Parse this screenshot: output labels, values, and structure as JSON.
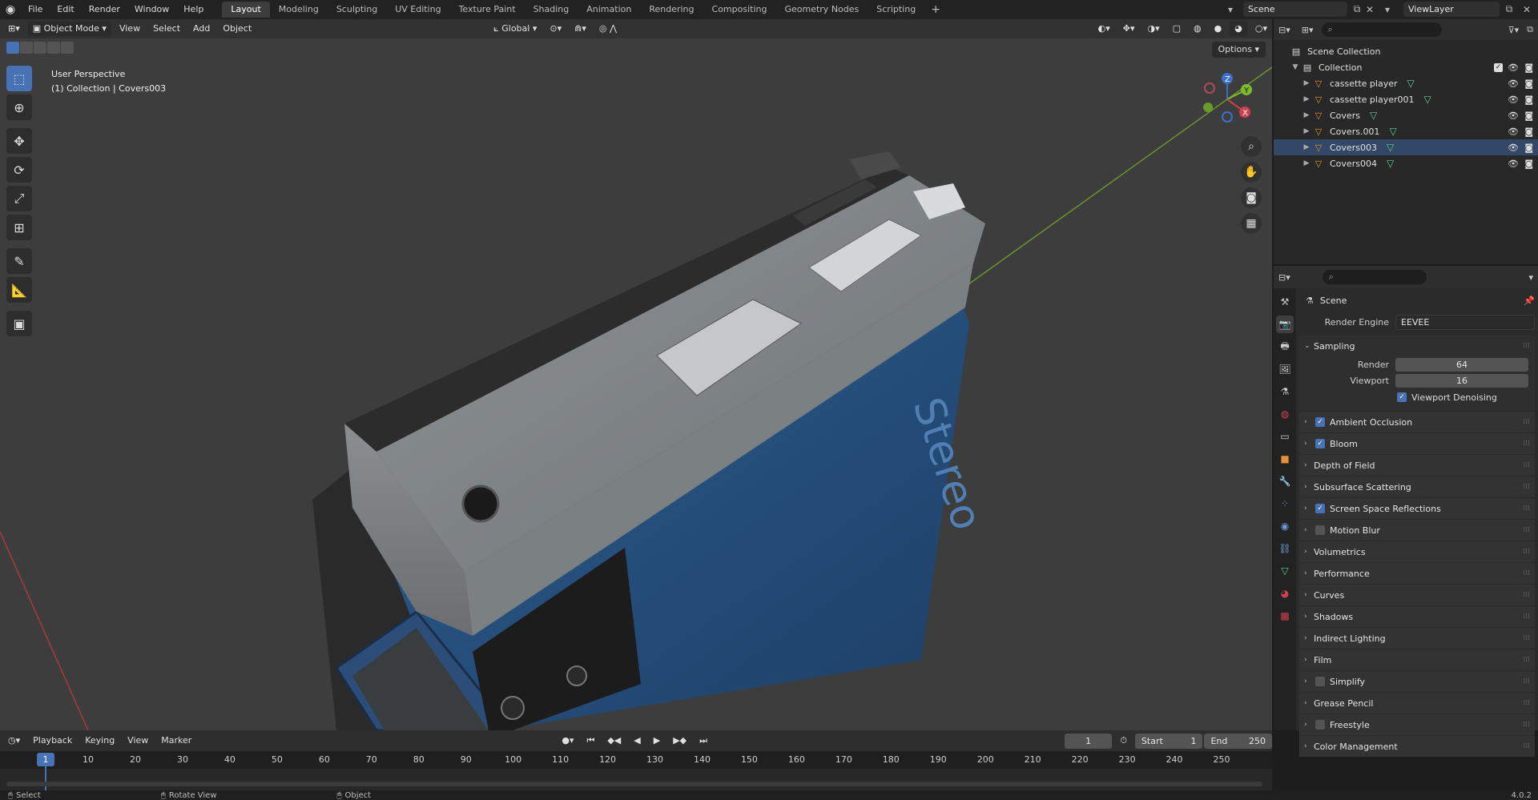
{
  "topbar": {
    "menu": [
      "File",
      "Edit",
      "Render",
      "Window",
      "Help"
    ],
    "workspaces": [
      "Layout",
      "Modeling",
      "Sculpting",
      "UV Editing",
      "Texture Paint",
      "Shading",
      "Animation",
      "Rendering",
      "Compositing",
      "Geometry Nodes",
      "Scripting"
    ],
    "active_workspace": "Layout",
    "add_tab": "+",
    "scene": "Scene",
    "view_layer": "ViewLayer"
  },
  "viewport": {
    "mode": "Object Mode",
    "menus": [
      "View",
      "Select",
      "Add",
      "Object"
    ],
    "orientation": "Global",
    "options": "Options",
    "info_line1": "User Perspective",
    "info_line2": "(1) Collection | Covers003",
    "model_label": "Stereo",
    "gizmo": {
      "z": "Z",
      "y": "Y",
      "x": "X"
    }
  },
  "outliner": {
    "root": "Scene Collection",
    "collection": "Collection",
    "objects": [
      {
        "name": "cassette player",
        "selected": false
      },
      {
        "name": "cassette player001",
        "selected": false
      },
      {
        "name": "Covers",
        "selected": false
      },
      {
        "name": "Covers.001",
        "selected": false
      },
      {
        "name": "Covers003",
        "selected": true
      },
      {
        "name": "Covers004",
        "selected": false
      }
    ]
  },
  "properties": {
    "scene_label": "Scene",
    "render_engine_label": "Render Engine",
    "render_engine": "EEVEE",
    "sampling": {
      "title": "Sampling",
      "render_label": "Render",
      "render_value": "64",
      "viewport_label": "Viewport",
      "viewport_value": "16",
      "denoise_label": "Viewport Denoising"
    },
    "panels": [
      {
        "label": "Ambient Occlusion",
        "checkbox": true,
        "checked": true
      },
      {
        "label": "Bloom",
        "checkbox": true,
        "checked": true
      },
      {
        "label": "Depth of Field",
        "checkbox": false,
        "checked": false
      },
      {
        "label": "Subsurface Scattering",
        "checkbox": false,
        "checked": false
      },
      {
        "label": "Screen Space Reflections",
        "checkbox": true,
        "checked": true
      },
      {
        "label": "Motion Blur",
        "checkbox": true,
        "checked": false
      },
      {
        "label": "Volumetrics",
        "checkbox": false,
        "checked": false
      },
      {
        "label": "Performance",
        "checkbox": false,
        "checked": false
      },
      {
        "label": "Curves",
        "checkbox": false,
        "checked": false
      },
      {
        "label": "Shadows",
        "checkbox": false,
        "checked": false
      },
      {
        "label": "Indirect Lighting",
        "checkbox": false,
        "checked": false
      },
      {
        "label": "Film",
        "checkbox": false,
        "checked": false
      },
      {
        "label": "Simplify",
        "checkbox": true,
        "checked": false
      },
      {
        "label": "Grease Pencil",
        "checkbox": false,
        "checked": false
      },
      {
        "label": "Freestyle",
        "checkbox": true,
        "checked": false
      },
      {
        "label": "Color Management",
        "checkbox": false,
        "checked": false
      }
    ]
  },
  "timeline": {
    "menus": [
      "Playback",
      "Keying",
      "View",
      "Marker"
    ],
    "current_frame": "1",
    "start_label": "Start",
    "start": "1",
    "end_label": "End",
    "end": "250",
    "ticks": [
      "10",
      "20",
      "30",
      "40",
      "50",
      "60",
      "70",
      "80",
      "90",
      "100",
      "110",
      "120",
      "130",
      "140",
      "150",
      "160",
      "170",
      "180",
      "190",
      "200",
      "210",
      "220",
      "230",
      "240",
      "250"
    ]
  },
  "statusbar": {
    "items": [
      "Select",
      "Rotate View",
      "Object"
    ],
    "version": "4.0.2"
  },
  "colors": {
    "accent": "#4772b3",
    "object_icon": "#e5913a",
    "modifier_icon": "#5cd196"
  }
}
